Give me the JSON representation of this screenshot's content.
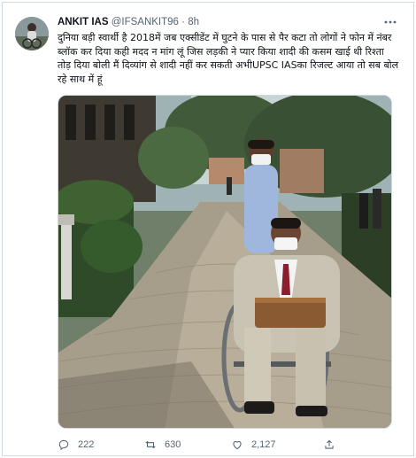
{
  "tweet": {
    "author_name": "ANKIT IAS",
    "handle": "@IFSANKIT96",
    "separator": "·",
    "time": "8h",
    "text": "दुनिया बड़ी स्वार्थी है 2018में जब एक्सीडेंट में घुटने के पास से पैर कटा तो लोगों ने फोन में नंबर ब्लॉक कर दिया कही मदद न मांग लूं जिस लड़की ने प्यार किया शादी की कसम खाई थी रिश्ता तोड़ दिया बोली मैं दिव्यांग से शादी नहीं कर सकती अभीUPSC IASका रिजल्ट आया तो सब बोल रहे साथ में हूं"
  },
  "stats": {
    "replies": "222",
    "retweets": "630",
    "likes": "2,127"
  },
  "icons": {
    "more": "more-horizontal-icon",
    "reply": "reply-icon",
    "retweet": "retweet-icon",
    "like": "heart-icon",
    "share": "share-icon"
  },
  "colors": {
    "text": "#0f1419",
    "secondary": "#536471",
    "border": "#cfd9de"
  }
}
